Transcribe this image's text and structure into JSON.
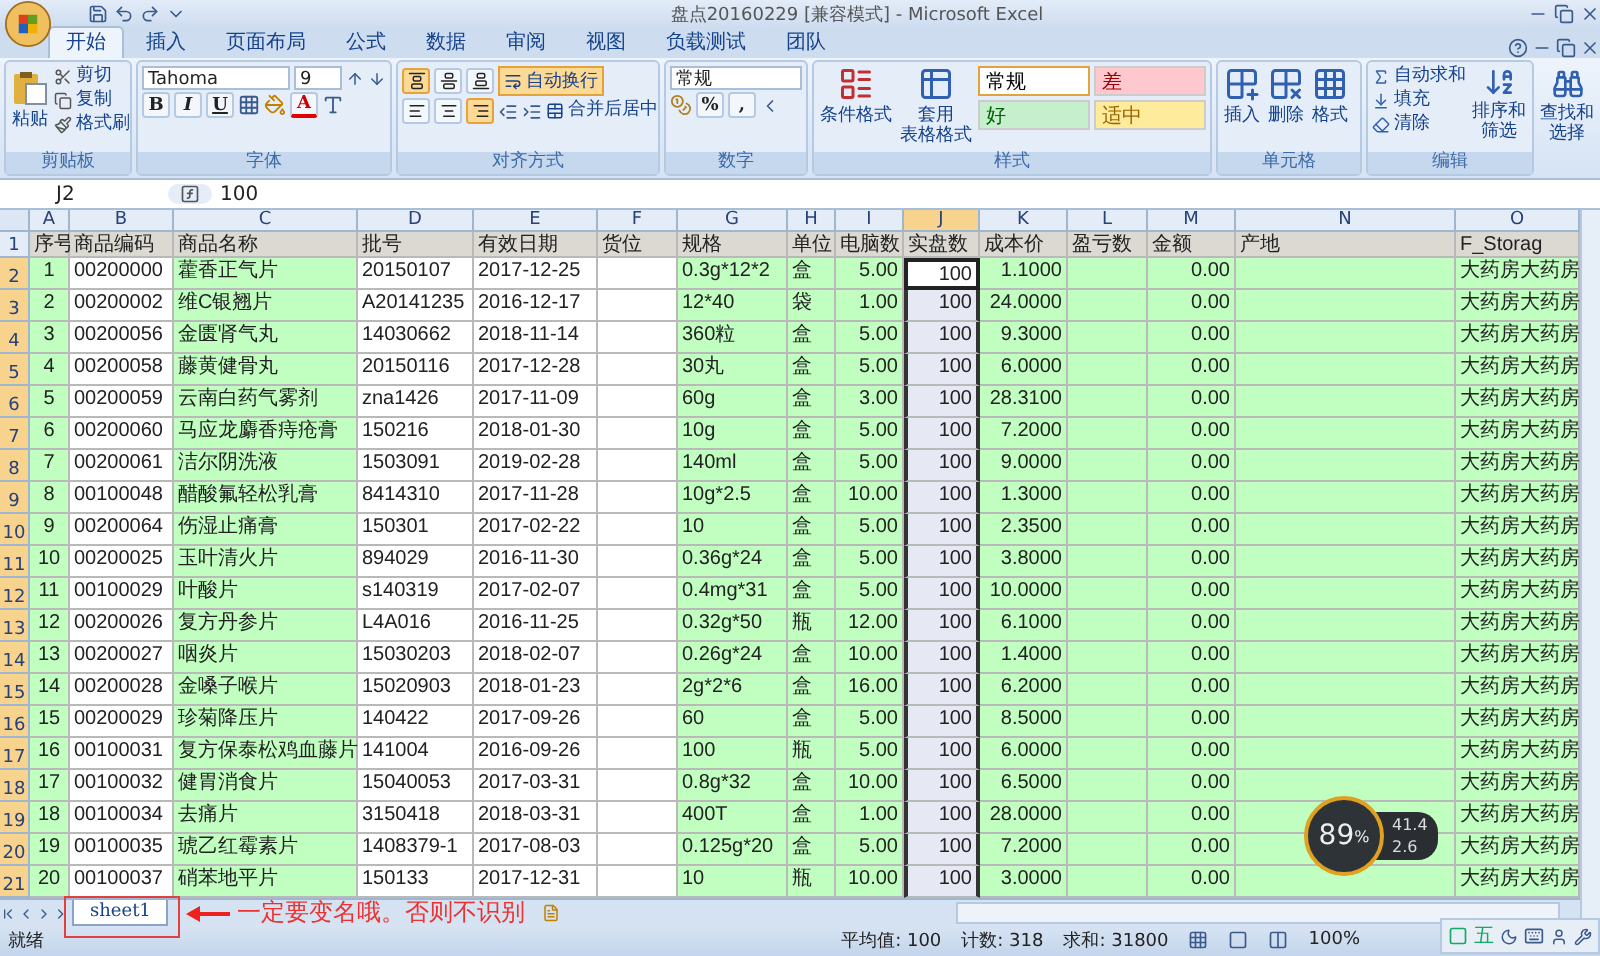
{
  "window": {
    "title": "盘点20160229 [兼容模式] - Microsoft Excel"
  },
  "tabs": [
    {
      "label": "开始",
      "selected": true
    },
    {
      "label": "插入",
      "selected": false
    },
    {
      "label": "页面布局",
      "selected": false
    },
    {
      "label": "公式",
      "selected": false
    },
    {
      "label": "数据",
      "selected": false
    },
    {
      "label": "审阅",
      "selected": false
    },
    {
      "label": "视图",
      "selected": false
    },
    {
      "label": "负载测试",
      "selected": false
    },
    {
      "label": "团队",
      "selected": false
    }
  ],
  "ribbon": {
    "clipboard": {
      "label": "剪贴板",
      "paste": "粘贴",
      "items": [
        "剪切",
        "复制",
        "格式刷"
      ]
    },
    "font": {
      "label": "字体",
      "name": "Tahoma",
      "size": "9",
      "styles": [
        "B",
        "I",
        "U"
      ],
      "color_letter": "A"
    },
    "alignment": {
      "label": "对齐方式",
      "valign": [
        {
          "selected": true
        },
        {
          "selected": false
        },
        {
          "selected": false
        }
      ],
      "halign": [
        {
          "selected": false
        },
        {
          "selected": false
        },
        {
          "selected": true
        }
      ],
      "wrap": {
        "label": "自动换行",
        "selected": true
      },
      "merge": "合并后居中"
    },
    "number": {
      "label": "数字",
      "format": "常规",
      "symbols": [
        "%",
        ","
      ]
    },
    "styles": {
      "label": "样式",
      "conditional": "条件格式",
      "table": [
        "套用",
        "表格格式"
      ],
      "cells": [
        {
          "label": "常规",
          "kind": "normal",
          "selected": true
        },
        {
          "label": "差",
          "kind": "bad",
          "selected": false
        },
        {
          "label": "好",
          "kind": "good",
          "selected": false
        },
        {
          "label": "适中",
          "kind": "neutral",
          "selected": false
        }
      ]
    },
    "cells": {
      "label": "单元格",
      "items": [
        "插入",
        "删除",
        "格式"
      ]
    },
    "editing": {
      "label": "编辑",
      "items": [
        "自动求和",
        "填充",
        "清除"
      ],
      "sort": [
        "排序和",
        "筛选"
      ],
      "find": [
        "查找和",
        "选择"
      ]
    }
  },
  "formula_bar": {
    "name_box": "J2",
    "value": "100"
  },
  "columns": [
    {
      "letter": "A",
      "color": "#c0ffc0",
      "selected": false
    },
    {
      "letter": "B",
      "color": "#ffffff",
      "selected": false
    },
    {
      "letter": "C",
      "color": "#c0ffc0",
      "selected": false
    },
    {
      "letter": "D",
      "color": "#ffffff",
      "selected": false
    },
    {
      "letter": "E",
      "color": "#ffffff",
      "selected": false
    },
    {
      "letter": "F",
      "color": "#ffffff",
      "selected": false
    },
    {
      "letter": "G",
      "color": "#c0ffc0",
      "selected": false
    },
    {
      "letter": "H",
      "color": "#c0ffc0",
      "selected": false
    },
    {
      "letter": "I",
      "color": "#c0ffc0",
      "selected": false
    },
    {
      "letter": "J",
      "selected": true
    },
    {
      "letter": "K",
      "color": "#c0ffc0",
      "selected": false
    },
    {
      "letter": "L",
      "color": "#c0ffc0",
      "selected": false
    },
    {
      "letter": "M",
      "color": "#c0ffc0",
      "selected": false
    },
    {
      "letter": "N",
      "color": "#c0ffc0",
      "selected": false
    },
    {
      "letter": "O",
      "color": "#c0ffc0",
      "selected": false
    }
  ],
  "rows": [
    {
      "num": "1",
      "kind": "header",
      "selected": false,
      "active": false,
      "cells": [
        "序号",
        "商品编码",
        "商品名称",
        "批号",
        "有效日期",
        "货位",
        "规格",
        "单位",
        "电脑数",
        "实盘数",
        "成本价",
        "盈亏数",
        "金额",
        "产地",
        "F_Storag"
      ]
    },
    {
      "num": "2",
      "kind": "data",
      "selected": true,
      "active": true,
      "cells": [
        "1",
        "00200000",
        "藿香正气片",
        "20150107",
        "2017-12-25",
        null,
        "0.3g*12*2",
        "盒",
        "5.00",
        "100",
        "1.1000",
        null,
        "0.00",
        null,
        "大药房大药房"
      ]
    },
    {
      "num": "3",
      "kind": "data",
      "selected": true,
      "active": false,
      "cells": [
        "2",
        "00200002",
        "维C银翘片",
        "A20141235",
        "2016-12-17",
        null,
        "12*40",
        "袋",
        "1.00",
        "100",
        "24.0000",
        null,
        "0.00",
        null,
        "大药房大药房"
      ]
    },
    {
      "num": "4",
      "kind": "data",
      "selected": true,
      "active": false,
      "cells": [
        "3",
        "00200056",
        "金匮肾气丸",
        "14030662",
        "2018-11-14",
        null,
        "360粒",
        "盒",
        "5.00",
        "100",
        "9.3000",
        null,
        "0.00",
        null,
        "大药房大药房"
      ]
    },
    {
      "num": "5",
      "kind": "data",
      "selected": true,
      "active": false,
      "cells": [
        "4",
        "00200058",
        "藤黄健骨丸",
        "20150116",
        "2017-12-28",
        null,
        "30丸",
        "盒",
        "5.00",
        "100",
        "6.0000",
        null,
        "0.00",
        null,
        "大药房大药房"
      ]
    },
    {
      "num": "6",
      "kind": "data",
      "selected": true,
      "active": false,
      "cells": [
        "5",
        "00200059",
        "云南白药气雾剂",
        "zna1426",
        "2017-11-09",
        null,
        "60g",
        "盒",
        "3.00",
        "100",
        "28.3100",
        null,
        "0.00",
        null,
        "大药房大药房"
      ]
    },
    {
      "num": "7",
      "kind": "data",
      "selected": true,
      "active": false,
      "cells": [
        "6",
        "00200060",
        "马应龙麝香痔疮膏",
        "150216",
        "2018-01-30",
        null,
        "10g",
        "盒",
        "5.00",
        "100",
        "7.2000",
        null,
        "0.00",
        null,
        "大药房大药房"
      ]
    },
    {
      "num": "8",
      "kind": "data",
      "selected": true,
      "active": false,
      "cells": [
        "7",
        "00200061",
        "洁尔阴洗液",
        "1503091",
        "2019-02-28",
        null,
        "140ml",
        "盒",
        "5.00",
        "100",
        "9.0000",
        null,
        "0.00",
        null,
        "大药房大药房"
      ]
    },
    {
      "num": "9",
      "kind": "data",
      "selected": true,
      "active": false,
      "cells": [
        "8",
        "00100048",
        "醋酸氟轻松乳膏",
        "8414310",
        "2017-11-28",
        null,
        "10g*2.5",
        "盒",
        "10.00",
        "100",
        "1.3000",
        null,
        "0.00",
        null,
        "大药房大药房"
      ]
    },
    {
      "num": "10",
      "kind": "data",
      "selected": true,
      "active": false,
      "cells": [
        "9",
        "00200064",
        "伤湿止痛膏",
        "150301",
        "2017-02-22",
        null,
        "10",
        "盒",
        "5.00",
        "100",
        "2.3500",
        null,
        "0.00",
        null,
        "大药房大药房"
      ]
    },
    {
      "num": "11",
      "kind": "data",
      "selected": true,
      "active": false,
      "cells": [
        "10",
        "00200025",
        "玉叶清火片",
        "894029",
        "2016-11-30",
        null,
        "0.36g*24",
        "盒",
        "5.00",
        "100",
        "3.8000",
        null,
        "0.00",
        null,
        "大药房大药房"
      ]
    },
    {
      "num": "12",
      "kind": "data",
      "selected": true,
      "active": false,
      "cells": [
        "11",
        "00100029",
        "叶酸片",
        "s140319",
        "2017-02-07",
        null,
        "0.4mg*31",
        "盒",
        "5.00",
        "100",
        "10.0000",
        null,
        "0.00",
        null,
        "大药房大药房"
      ]
    },
    {
      "num": "13",
      "kind": "data",
      "selected": true,
      "active": false,
      "cells": [
        "12",
        "00200026",
        "复方丹参片",
        "L4A016",
        "2016-11-25",
        null,
        "0.32g*50",
        "瓶",
        "12.00",
        "100",
        "6.1000",
        null,
        "0.00",
        null,
        "大药房大药房"
      ]
    },
    {
      "num": "14",
      "kind": "data",
      "selected": true,
      "active": false,
      "cells": [
        "13",
        "00200027",
        "咽炎片",
        "15030203",
        "2018-02-07",
        null,
        "0.26g*24",
        "盒",
        "10.00",
        "100",
        "1.4000",
        null,
        "0.00",
        null,
        "大药房大药房"
      ]
    },
    {
      "num": "15",
      "kind": "data",
      "selected": true,
      "active": false,
      "cells": [
        "14",
        "00200028",
        "金嗓子喉片",
        "15020903",
        "2018-01-23",
        null,
        "2g*2*6",
        "盒",
        "16.00",
        "100",
        "6.2000",
        null,
        "0.00",
        null,
        "大药房大药房"
      ]
    },
    {
      "num": "16",
      "kind": "data",
      "selected": true,
      "active": false,
      "cells": [
        "15",
        "00200029",
        "珍菊降压片",
        "140422",
        "2017-09-26",
        null,
        "60",
        "盒",
        "5.00",
        "100",
        "8.5000",
        null,
        "0.00",
        null,
        "大药房大药房"
      ]
    },
    {
      "num": "17",
      "kind": "data",
      "selected": true,
      "active": false,
      "cells": [
        "16",
        "00100031",
        "复方保泰松鸡血藤片",
        "141004",
        "2016-09-26",
        null,
        "100",
        "瓶",
        "5.00",
        "100",
        "6.0000",
        null,
        "0.00",
        null,
        "大药房大药房"
      ]
    },
    {
      "num": "18",
      "kind": "data",
      "selected": true,
      "active": false,
      "cells": [
        "17",
        "00100032",
        "健胃消食片",
        "15040053",
        "2017-03-31",
        null,
        "0.8g*32",
        "盒",
        "10.00",
        "100",
        "6.5000",
        null,
        "0.00",
        null,
        "大药房大药房"
      ]
    },
    {
      "num": "19",
      "kind": "data",
      "selected": true,
      "active": false,
      "cells": [
        "18",
        "00100034",
        "去痛片",
        "3150418",
        "2018-03-31",
        null,
        "400T",
        "盒",
        "1.00",
        "100",
        "28.0000",
        null,
        "0.00",
        null,
        "大药房大药房"
      ]
    },
    {
      "num": "20",
      "kind": "data",
      "selected": true,
      "active": false,
      "cells": [
        "19",
        "00100035",
        "琥乙红霉素片",
        "1408379-1",
        "2017-08-03",
        null,
        "0.125g*20",
        "盒",
        "5.00",
        "100",
        "7.2000",
        null,
        "0.00",
        null,
        "大药房大药房"
      ]
    },
    {
      "num": "21",
      "kind": "data",
      "selected": true,
      "active": false,
      "cells": [
        "20",
        "00100037",
        "硝苯地平片",
        "150133",
        "2017-12-31",
        null,
        "10",
        "瓶",
        "10.00",
        "100",
        "3.0000",
        null,
        "0.00",
        null,
        "大药房大药房"
      ]
    }
  ],
  "sheet_tabs": [
    {
      "label": "sheet1",
      "selected": true
    }
  ],
  "status_bar": {
    "state": "就绪",
    "average": "平均值: 100",
    "count": "计数: 318",
    "sum": "求和: 31800",
    "zoom": "100%"
  },
  "annotation": {
    "text": "一定要变名哦。否则不识别"
  },
  "net_widget": {
    "percent": "89",
    "unit": "%",
    "up": "41.4",
    "down": "2.6"
  },
  "tray": {
    "ime": "五"
  }
}
